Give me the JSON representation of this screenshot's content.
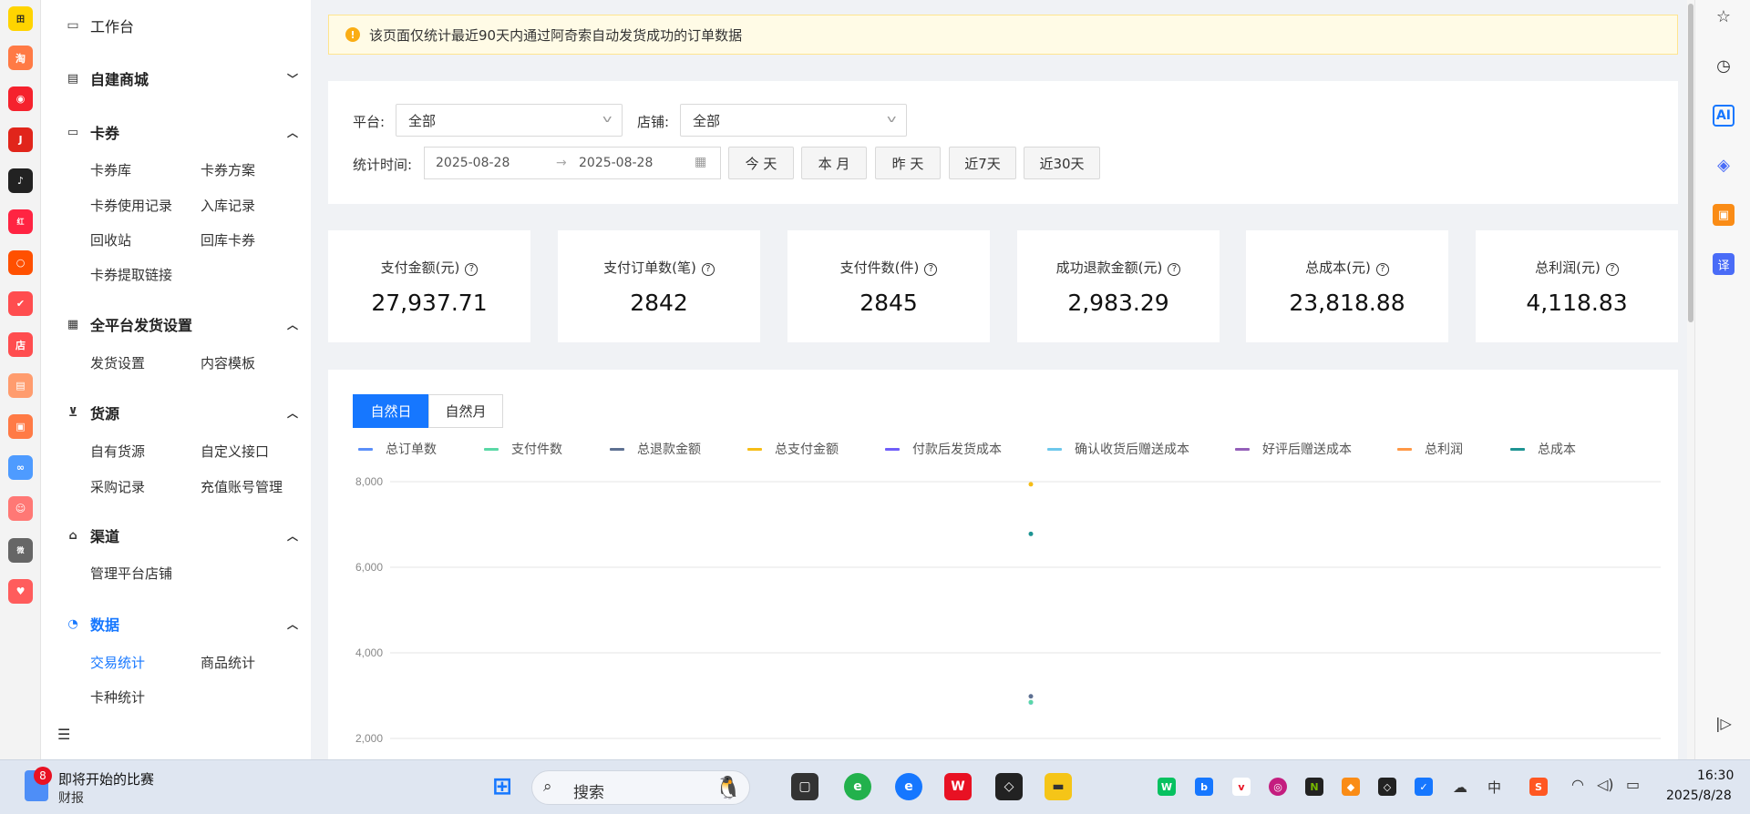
{
  "sidebar": {
    "workbench": "工作台",
    "groups": [
      {
        "label": "自建商城",
        "icon": "store-icon",
        "expanded": false
      },
      {
        "label": "卡券",
        "icon": "card-icon",
        "expanded": true
      },
      {
        "label": "全平台发货设置",
        "icon": "grid-icon",
        "expanded": true
      },
      {
        "label": "货源",
        "icon": "cart-icon",
        "expanded": true
      },
      {
        "label": "渠道",
        "icon": "bag-icon",
        "expanded": true
      },
      {
        "label": "数据",
        "icon": "pie-chart-icon",
        "expanded": true
      }
    ],
    "card_items": [
      "卡券库",
      "卡券方案",
      "卡券使用记录",
      "入库记录",
      "回收站",
      "回库卡券",
      "卡券提取链接"
    ],
    "ship_items": [
      "发货设置",
      "内容模板"
    ],
    "source_items": [
      "自有货源",
      "自定义接口",
      "采购记录",
      "充值账号管理"
    ],
    "channel_items": [
      "管理平台店铺"
    ],
    "data_items": [
      "交易统计",
      "商品统计",
      "卡种统计"
    ]
  },
  "notice": {
    "text": "该页面仅统计最近90天内通过阿奇索自动发货成功的订单数据"
  },
  "filter": {
    "platform_label": "平台:",
    "platform_value": "全部",
    "shop_label": "店铺:",
    "shop_value": "全部",
    "time_label": "统计时间:",
    "start_date": "2025-08-28",
    "end_date": "2025-08-28",
    "buttons": [
      "今 天",
      "本 月",
      "昨 天",
      "近7天",
      "近30天"
    ]
  },
  "stats": [
    {
      "title": "支付金额(元)",
      "value": "27,937.71"
    },
    {
      "title": "支付订单数(笔)",
      "value": "2842"
    },
    {
      "title": "支付件数(件)",
      "value": "2845"
    },
    {
      "title": "成功退款金额(元)",
      "value": "2,983.29"
    },
    {
      "title": "总成本(元)",
      "value": "23,818.88"
    },
    {
      "title": "总利润(元)",
      "value": "4,118.83"
    }
  ],
  "chart_tabs": [
    "自然日",
    "自然月"
  ],
  "chart_data": {
    "type": "scatter",
    "ylim": [
      0,
      8000
    ],
    "yticks": [
      "8,000",
      "6,000",
      "4,000",
      "2,000"
    ],
    "series": [
      {
        "name": "总订单数",
        "color": "#5b8ff9",
        "values": [
          2842
        ]
      },
      {
        "name": "支付件数",
        "color": "#5ad8a6",
        "values": [
          2845
        ]
      },
      {
        "name": "总退款金额",
        "color": "#5d7092",
        "values": [
          2983.29
        ]
      },
      {
        "name": "总支付金额",
        "color": "#f6bd16",
        "values": [
          7938
        ]
      },
      {
        "name": "付款后发货成本",
        "color": "#6f5ef9",
        "values": []
      },
      {
        "name": "确认收货后赠送成本",
        "color": "#6dc8ec",
        "values": []
      },
      {
        "name": "好评后赠送成本",
        "color": "#945fb9",
        "values": []
      },
      {
        "name": "总利润",
        "color": "#ff9845",
        "values": []
      },
      {
        "name": "总成本",
        "color": "#1e9493",
        "values": [
          6780
        ]
      }
    ],
    "legend_position": "top"
  },
  "taskbar": {
    "news_title": "即将开始的比赛",
    "news_sub": "财报",
    "news_badge": "8",
    "search_placeholder": "搜索",
    "ime": "中",
    "time": "16:30",
    "date": "2025/8/28"
  },
  "edge": {
    "ai_label": "AI",
    "translate_label": "译"
  }
}
